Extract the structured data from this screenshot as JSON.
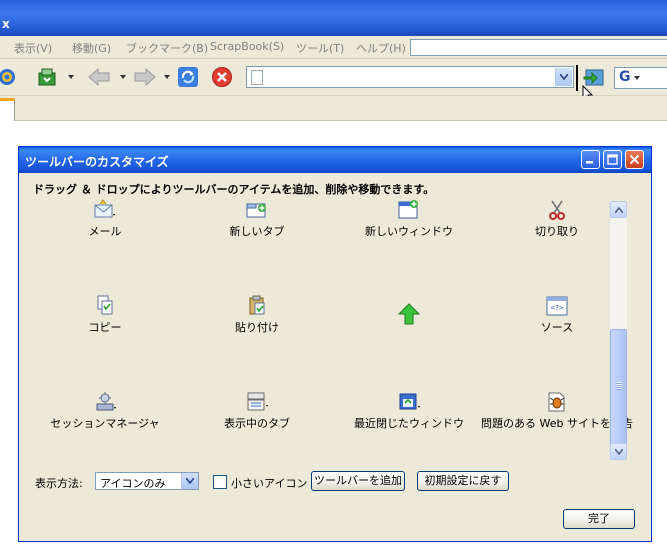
{
  "browser": {
    "title_fragment": "x",
    "menu": [
      {
        "label": "表示(V)"
      },
      {
        "label": "移動(G)"
      },
      {
        "label": "ブックマーク(B)"
      },
      {
        "label": "ScrapBook(S)"
      },
      {
        "label": "ツール(T)"
      },
      {
        "label": "ヘルプ(H)"
      }
    ],
    "search_engine_letter": "G",
    "icons": [
      "home-icon",
      "download-icon",
      "back-arrow-icon",
      "forward-arrow-icon",
      "reload-icon",
      "stop-icon",
      "go-icon",
      "drag-cursor-icon"
    ]
  },
  "dialog": {
    "title": "ツールバーのカスタマイズ",
    "instructions": "ドラッグ ＆ ドロップによりツールバーのアイテムを追加、削除や移動できます。",
    "items": [
      {
        "label": "メール",
        "icon": "mail-icon"
      },
      {
        "label": "新しいタブ",
        "icon": "new-tab-icon"
      },
      {
        "label": "新しいウィンドウ",
        "icon": "new-window-icon"
      },
      {
        "label": "切り取り",
        "icon": "scissors-icon"
      },
      {
        "label": "コピー",
        "icon": "copy-icon"
      },
      {
        "label": "貼り付け",
        "icon": "paste-icon"
      },
      {
        "label": "",
        "icon": "up-arrow-icon"
      },
      {
        "label": "ソース",
        "icon": "view-source-icon"
      },
      {
        "label": "セッションマネージャ",
        "icon": "session-manager-icon"
      },
      {
        "label": "表示中のタブ",
        "icon": "tab-list-icon"
      },
      {
        "label": "最近閉じたウィンドウ",
        "icon": "closed-windows-icon"
      },
      {
        "label": "問題のある Web サイトを報告",
        "icon": "report-bug-icon"
      }
    ],
    "show_label": "表示方法:",
    "show_value": "アイコンのみ",
    "small_icons_label": "小さいアイコン",
    "small_icons_checked": false,
    "add_toolbar_button": "ツールバーを追加",
    "restore_default_button": "初期設定に戻す",
    "done_button": "完了"
  },
  "colors": {
    "titlebar_blue": "#2458d0",
    "dialog_bg": "#ece9d8",
    "close_red": "#c6401c"
  }
}
